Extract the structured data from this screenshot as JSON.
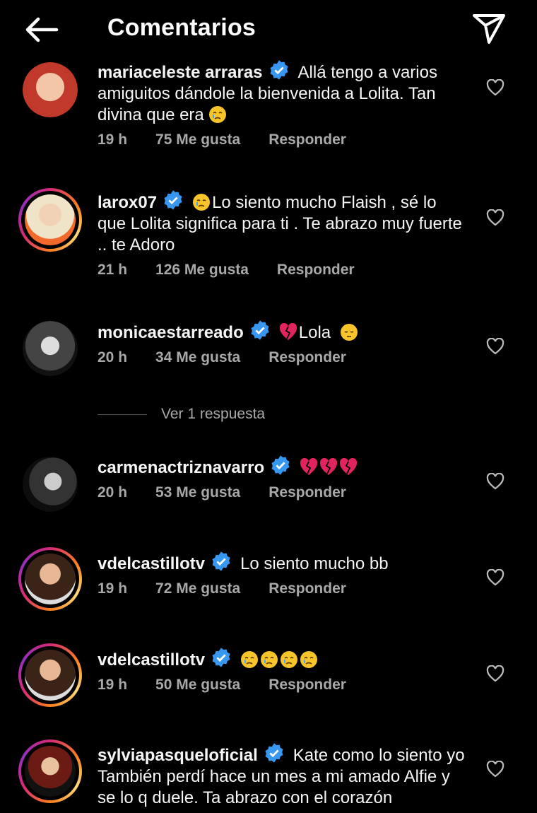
{
  "header": {
    "title": "Comentarios"
  },
  "comments": [
    {
      "username": "mariaceleste arraras",
      "text": "Allá tengo a varios amiguitos dándole la bienvenida a Lolita. Tan divina que era",
      "time": "19 h",
      "likes": "75 Me gusta",
      "reply": "Responder"
    },
    {
      "username": "larox07",
      "text": "Lo siento mucho Flaish , sé lo que Lolita significa para ti . Te abrazo muy fuerte .. te Adoro",
      "time": "21 h",
      "likes": "126 Me gusta",
      "reply": "Responder"
    },
    {
      "username": "monicaestarreado",
      "text": "Lola",
      "time": "20 h",
      "likes": "34 Me gusta",
      "reply": "Responder"
    },
    {
      "username": "carmenactriznavarro",
      "text": "",
      "time": "20 h",
      "likes": "53 Me gusta",
      "reply": "Responder"
    },
    {
      "username": "vdelcastillotv",
      "text": "Lo siento mucho bb",
      "time": "19 h",
      "likes": "72 Me gusta",
      "reply": "Responder"
    },
    {
      "username": "vdelcastillotv",
      "text": "",
      "time": "19 h",
      "likes": "50 Me gusta",
      "reply": "Responder"
    },
    {
      "username": "sylviapasqueloficial",
      "text": "Kate como lo siento yo También perdí hace un mes a mi amado Alfie y se lo q duele.  Ta abrazo con el corazón",
      "time": "",
      "likes": "",
      "reply": ""
    }
  ],
  "view_replies": "Ver 1 respuesta",
  "colors": {
    "background": "#000000",
    "meta_text": "#a8a8a8",
    "verified": "#3897f0"
  }
}
